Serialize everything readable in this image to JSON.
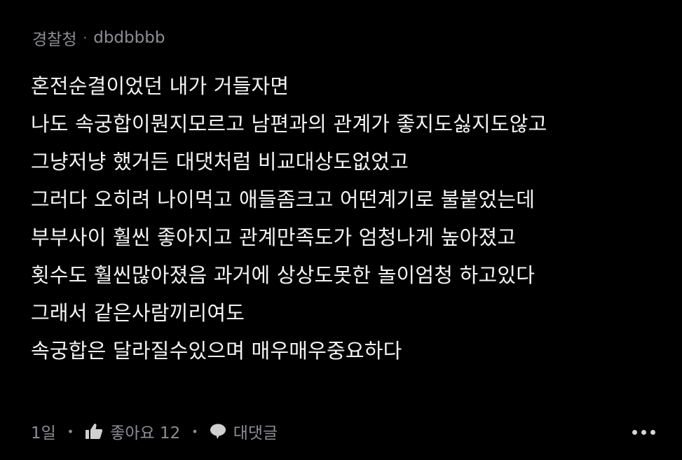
{
  "comment": {
    "author_group": "경찰청",
    "separator": "·",
    "author_name": "dbdbbbb",
    "lines": [
      "혼전순결이었던 내가 거들자면",
      "나도 속궁합이뭔지모르고 남편과의 관계가 좋지도싫지도않고",
      "그냥저냥 했거든 대댓처럼 비교대상도없었고",
      "그러다 오히려 나이먹고 애들좀크고 어떤계기로 불붙었는데",
      "부부사이 훨씬 좋아지고 관계만족도가 엄청나게 높아졌고",
      "횟수도 훨씬많아졌음 과거에 상상도못한 놀이엄청 하고있다",
      "그래서 같은사람끼리여도",
      "속궁합은 달라질수있으며 매우매우중요하다"
    ],
    "time_ago": "1일",
    "like_label": "좋아요 12",
    "reply_label": "대댓글",
    "like_icon": "thumbs-up-icon",
    "reply_icon": "speech-bubble-icon",
    "more_icon": "more-options-icon"
  },
  "colors": {
    "background": "#000000",
    "text": "#f4f4f4",
    "muted": "#8e8e93"
  }
}
